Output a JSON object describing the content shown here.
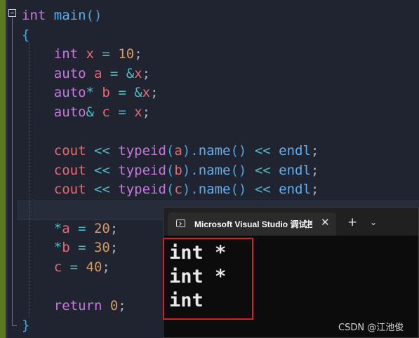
{
  "editor": {
    "lines": [
      [
        {
          "t": "int",
          "c": "ty"
        },
        {
          "t": " ",
          "c": "pu"
        },
        {
          "t": "main",
          "c": "fn"
        },
        {
          "t": "()",
          "c": "br"
        }
      ],
      [
        {
          "t": "{",
          "c": "br"
        }
      ],
      [
        {
          "t": "    int",
          "c": "ty"
        },
        {
          "t": " ",
          "c": "pu"
        },
        {
          "t": "x",
          "c": "id"
        },
        {
          "t": " = ",
          "c": "op"
        },
        {
          "t": "10",
          "c": "num"
        },
        {
          "t": ";",
          "c": "pu"
        }
      ],
      [
        {
          "t": "    auto",
          "c": "kw"
        },
        {
          "t": " ",
          "c": "pu"
        },
        {
          "t": "a",
          "c": "id"
        },
        {
          "t": " = &",
          "c": "op"
        },
        {
          "t": "x",
          "c": "id"
        },
        {
          "t": ";",
          "c": "pu"
        }
      ],
      [
        {
          "t": "    auto",
          "c": "kw"
        },
        {
          "t": "*",
          "c": "op"
        },
        {
          "t": " ",
          "c": "pu"
        },
        {
          "t": "b",
          "c": "id"
        },
        {
          "t": " = &",
          "c": "op"
        },
        {
          "t": "x",
          "c": "id"
        },
        {
          "t": ";",
          "c": "pu"
        }
      ],
      [
        {
          "t": "    auto",
          "c": "kw"
        },
        {
          "t": "&",
          "c": "op"
        },
        {
          "t": " ",
          "c": "pu"
        },
        {
          "t": "c",
          "c": "id"
        },
        {
          "t": " = ",
          "c": "op"
        },
        {
          "t": "x",
          "c": "id"
        },
        {
          "t": ";",
          "c": "pu"
        }
      ],
      [],
      [
        {
          "t": "    cout",
          "c": "id"
        },
        {
          "t": " << ",
          "c": "op"
        },
        {
          "t": "typeid",
          "c": "kw"
        },
        {
          "t": "(",
          "c": "br"
        },
        {
          "t": "a",
          "c": "id"
        },
        {
          "t": ").",
          "c": "br"
        },
        {
          "t": "name",
          "c": "fn"
        },
        {
          "t": "()",
          "c": "br"
        },
        {
          "t": " << ",
          "c": "op"
        },
        {
          "t": "endl",
          "c": "fn"
        },
        {
          "t": ";",
          "c": "pu"
        }
      ],
      [
        {
          "t": "    cout",
          "c": "id"
        },
        {
          "t": " << ",
          "c": "op"
        },
        {
          "t": "typeid",
          "c": "kw"
        },
        {
          "t": "(",
          "c": "br"
        },
        {
          "t": "b",
          "c": "id"
        },
        {
          "t": ").",
          "c": "br"
        },
        {
          "t": "name",
          "c": "fn"
        },
        {
          "t": "()",
          "c": "br"
        },
        {
          "t": " << ",
          "c": "op"
        },
        {
          "t": "endl",
          "c": "fn"
        },
        {
          "t": ";",
          "c": "pu"
        }
      ],
      [
        {
          "t": "    cout",
          "c": "id"
        },
        {
          "t": " << ",
          "c": "op"
        },
        {
          "t": "typeid",
          "c": "kw"
        },
        {
          "t": "(",
          "c": "br"
        },
        {
          "t": "c",
          "c": "id"
        },
        {
          "t": ").",
          "c": "br"
        },
        {
          "t": "name",
          "c": "fn"
        },
        {
          "t": "()",
          "c": "br"
        },
        {
          "t": " << ",
          "c": "op"
        },
        {
          "t": "endl",
          "c": "fn"
        },
        {
          "t": ";",
          "c": "pu"
        }
      ],
      [],
      [
        {
          "t": "    *",
          "c": "op"
        },
        {
          "t": "a",
          "c": "id"
        },
        {
          "t": " = ",
          "c": "op"
        },
        {
          "t": "20",
          "c": "num"
        },
        {
          "t": ";",
          "c": "pu"
        }
      ],
      [
        {
          "t": "    *",
          "c": "op"
        },
        {
          "t": "b",
          "c": "id"
        },
        {
          "t": " = ",
          "c": "op"
        },
        {
          "t": "30",
          "c": "num"
        },
        {
          "t": ";",
          "c": "pu"
        }
      ],
      [
        {
          "t": "    c",
          "c": "id"
        },
        {
          "t": " = ",
          "c": "op"
        },
        {
          "t": "40",
          "c": "num"
        },
        {
          "t": ";",
          "c": "pu"
        }
      ],
      [],
      [
        {
          "t": "    return",
          "c": "kw"
        },
        {
          "t": " ",
          "c": "pu"
        },
        {
          "t": "0",
          "c": "num"
        },
        {
          "t": ";",
          "c": "pu"
        }
      ],
      [
        {
          "t": "}",
          "c": "br"
        }
      ]
    ]
  },
  "terminal": {
    "tab_title": "Microsoft Visual Studio 调试控制台",
    "close_glyph": "✕",
    "new_tab_glyph": "+",
    "dropdown_glyph": "⌄",
    "output": [
      "int *",
      "int *",
      "int"
    ]
  },
  "watermark": "CSDN @江池俊"
}
